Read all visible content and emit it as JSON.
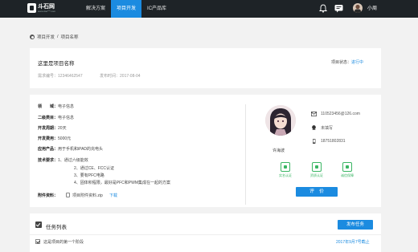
{
  "brand": {
    "name": "斗石网",
    "domain": "www.dou***.com"
  },
  "nav": {
    "items": [
      "解决方案",
      "项目开发",
      "IC产品库"
    ]
  },
  "user": {
    "name": "小周"
  },
  "breadcrumb": {
    "parent": "项目开发",
    "sep": "/",
    "current": "项目名称"
  },
  "project": {
    "title": "这里是项目名称",
    "code_label": "需求编号：",
    "code": "12346462547",
    "date_label": "发布时间：",
    "date": "2017-08-04",
    "status_label": "项目状态：",
    "status": "进行中"
  },
  "details": {
    "field_label": "领　　域：",
    "field": "电子信息",
    "cat_label": "二级类目：",
    "cat": "电子信息",
    "cycle_label": "开发周期：",
    "cycle": "20天",
    "budget_label": "开发费用：",
    "budget": "5000元",
    "product_label": "应用产品：",
    "product": "用于手机和iPAD的充电头",
    "tech_label": "技术要求：",
    "tech": [
      "1、通过六级能效",
      "2、通过CE、FCC认证",
      "3、要有PFC电路",
      "4、固体积程限，最好是PFC和PWM集成在一起的方案"
    ],
    "attach_label": "附件资料：",
    "attach_name": "项目附件资料.zip",
    "attach_download": "下载"
  },
  "person": {
    "name": "许海波",
    "email": "110523456@126.com",
    "qq": "未填写",
    "phone": "18751802831",
    "badges": [
      "实名认证",
      "资质认证",
      "诚信保障"
    ],
    "rate_label": "评　价"
  },
  "tasks": {
    "title": "任务列表",
    "publish": "发布任务",
    "items": [
      {
        "name": "这是项目的第一个阶段",
        "date": "2017年9月7号截止"
      }
    ]
  },
  "colors": {
    "nav_bg": "#1e2327",
    "accent": "#1b8be0",
    "badge": "#3ab563"
  }
}
